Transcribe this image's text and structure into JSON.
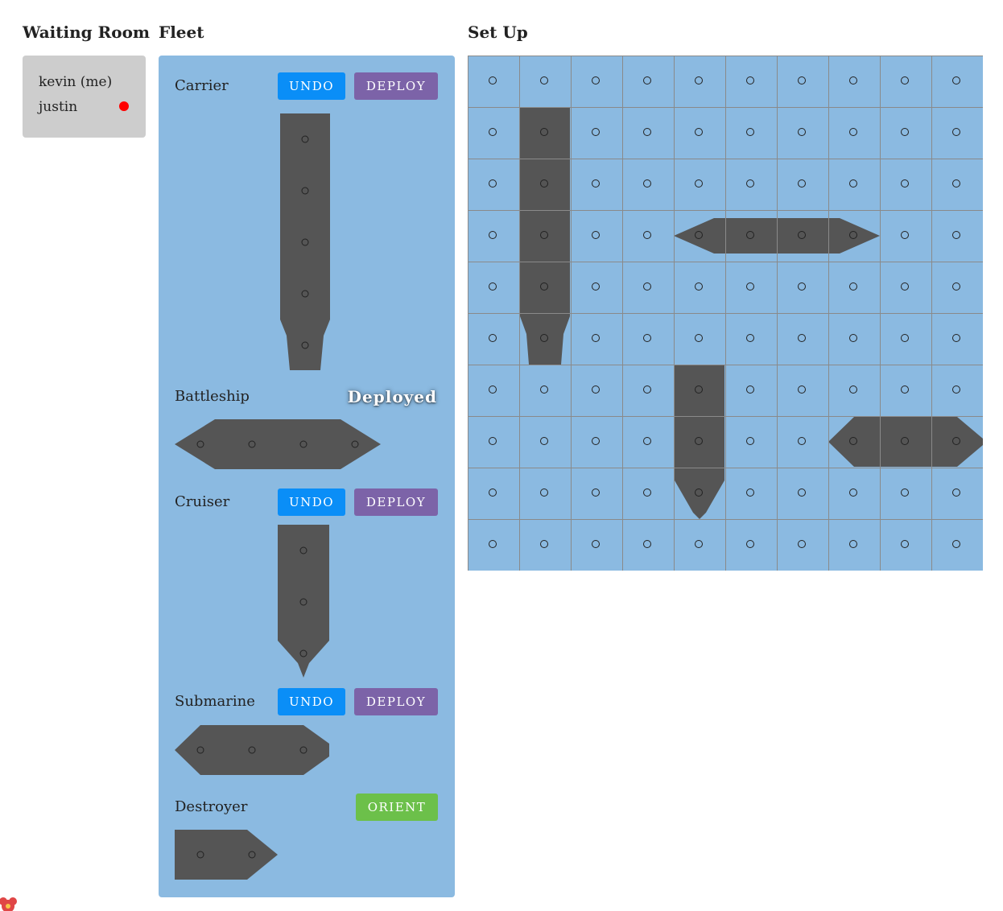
{
  "waiting_room": {
    "title": "Waiting Room",
    "players": [
      {
        "name": "kevin (me)",
        "status_dot": false
      },
      {
        "name": "justin",
        "status_dot": true
      }
    ],
    "status_dot_color": "#ff0000"
  },
  "fleet": {
    "title": "Fleet",
    "ships": [
      {
        "name": "Carrier",
        "orientation": "vertical",
        "cells": 5,
        "buttons": [
          "UNDO",
          "DEPLOY"
        ]
      },
      {
        "name": "Battleship",
        "orientation": "horizontal",
        "cells": 4,
        "status": "Deployed"
      },
      {
        "name": "Cruiser",
        "orientation": "vertical",
        "cells": 3,
        "buttons": [
          "UNDO",
          "DEPLOY"
        ]
      },
      {
        "name": "Submarine",
        "orientation": "horizontal",
        "cells": 3,
        "buttons": [
          "UNDO",
          "DEPLOY"
        ]
      },
      {
        "name": "Destroyer",
        "orientation": "horizontal",
        "cells": 2,
        "buttons": [
          "ORIENT"
        ]
      }
    ]
  },
  "board": {
    "title": "Set Up",
    "rows": 10,
    "cols": 10,
    "cell_marker": "o",
    "placed_ships": [
      {
        "ship": "Carrier",
        "orientation": "vertical",
        "row": 1,
        "col": 1,
        "cells": 5
      },
      {
        "ship": "Battleship",
        "orientation": "horizontal",
        "row": 3,
        "col": 4,
        "cells": 4
      },
      {
        "ship": "Cruiser",
        "orientation": "vertical",
        "row": 6,
        "col": 4,
        "cells": 3
      },
      {
        "ship": "Submarine",
        "orientation": "horizontal",
        "row": 7,
        "col": 7,
        "cells": 3
      }
    ]
  },
  "colors": {
    "water": "#8bbae1",
    "ship": "#555555",
    "undo_button": "#0a8ef7",
    "deploy_button": "#7c63a8",
    "orient_button": "#6cc04a",
    "waiting_room_bg": "#cdcdcd"
  },
  "icons": {
    "player_status": "red-dot-icon",
    "corner_decoration": "flower-icon"
  }
}
